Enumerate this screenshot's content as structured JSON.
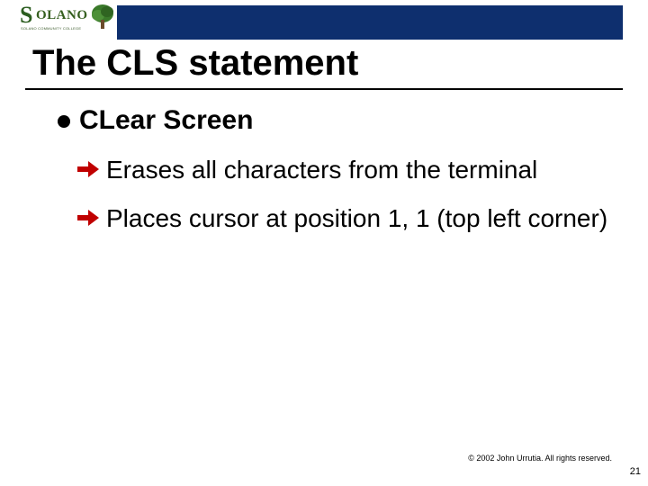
{
  "logo": {
    "big_letter": "S",
    "rest": "OLANO",
    "subtext": "SOLANO COMMUNITY COLLEGE"
  },
  "title": "The CLS statement",
  "bullets": {
    "lvl1": "CLear Screen",
    "sub1": "Erases all characters from the terminal",
    "sub2": "Places cursor at position 1, 1 (top left corner)"
  },
  "footer": {
    "copyright": "© 2002 John Urrutia. All rights reserved.",
    "page": "21"
  }
}
